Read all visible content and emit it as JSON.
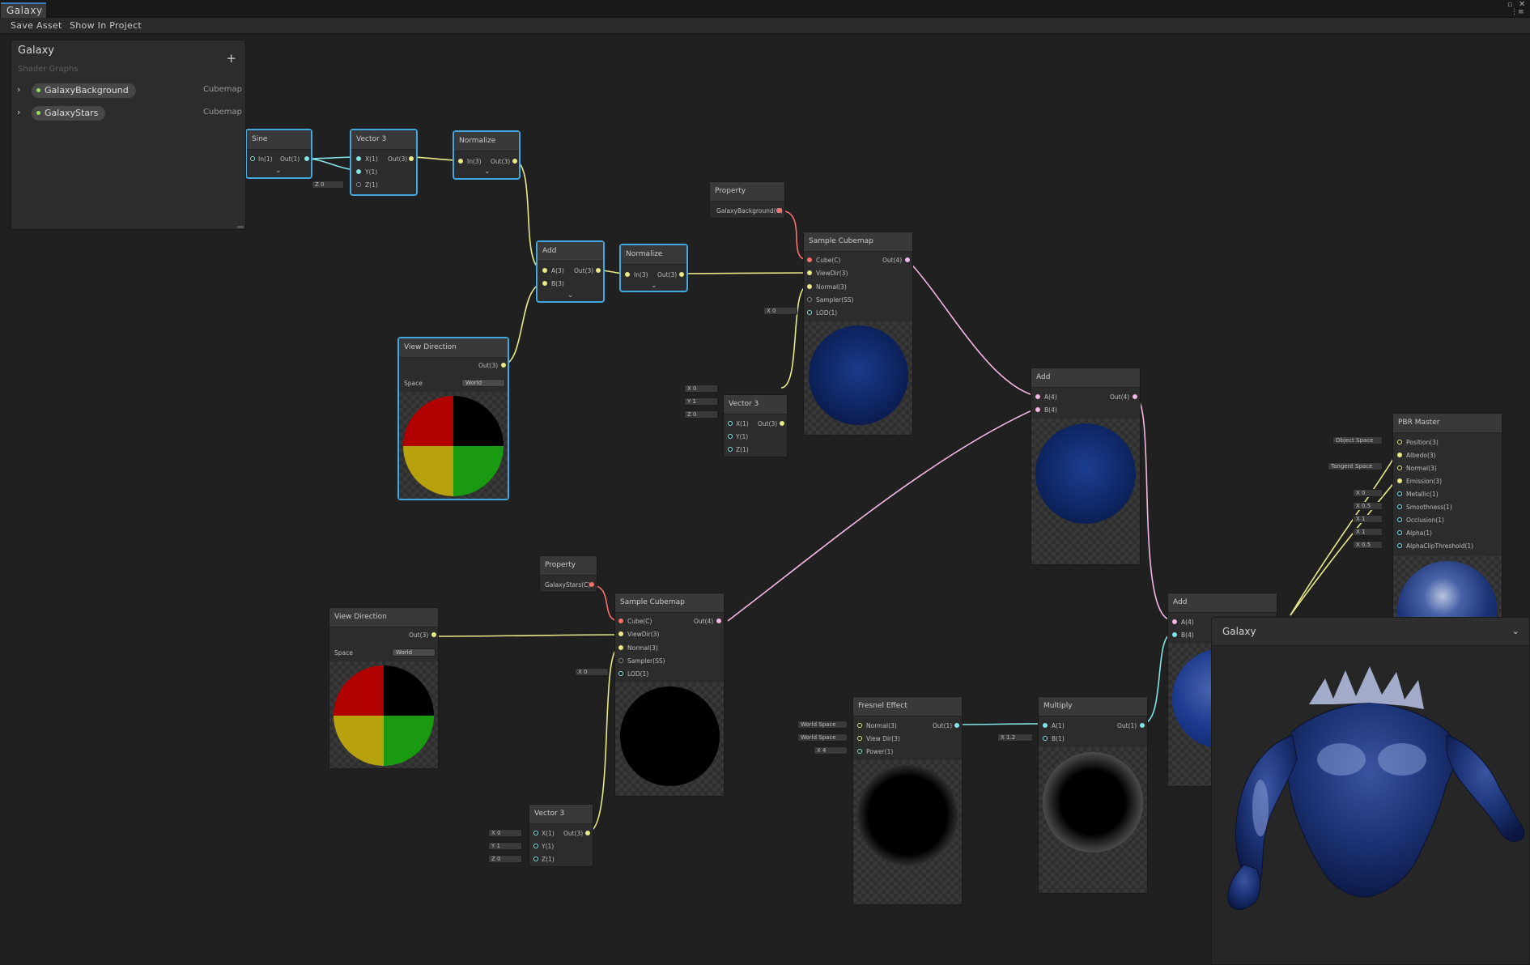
{
  "window": {
    "tab_title": "Galaxy"
  },
  "toolbar": {
    "save_asset": "Save Asset",
    "show_in_project": "Show In Project"
  },
  "blackboard": {
    "title": "Galaxy",
    "subtitle": "Shader Graphs",
    "add_symbol": "+",
    "properties": [
      {
        "name": "GalaxyBackground",
        "type": "Cubemap"
      },
      {
        "name": "GalaxyStars",
        "type": "Cubemap"
      }
    ]
  },
  "nodes": {
    "sine": {
      "title": "Sine",
      "in": "In(1)",
      "out": "Out(1)"
    },
    "vector3_top": {
      "title": "Vector 3",
      "x": "X(1)",
      "y": "Y(1)",
      "z": "Z(1)",
      "out": "Out(3)",
      "z_value": "Z 0"
    },
    "normalize_1": {
      "title": "Normalize",
      "in": "In(3)",
      "out": "Out(3)"
    },
    "add_1": {
      "title": "Add",
      "a": "A(3)",
      "b": "B(3)",
      "out": "Out(3)"
    },
    "normalize_2": {
      "title": "Normalize",
      "in": "In(3)",
      "out": "Out(3)"
    },
    "property_bg": {
      "title": "Property",
      "value": "GalaxyBackground(C)"
    },
    "sample_cubemap_1": {
      "title": "Sample Cubemap",
      "cube": "Cube(C)",
      "viewdir": "ViewDir(3)",
      "normal": "Normal(3)",
      "sampler": "Sampler(SS)",
      "lod": "LOD(1)",
      "out": "Out(4)",
      "lod_value": "X 0"
    },
    "view_direction_1": {
      "title": "View Direction",
      "out": "Out(3)",
      "space_label": "Space",
      "space_value": "World"
    },
    "vector3_mid": {
      "title": "Vector 3",
      "x": "X(1)",
      "y": "Y(1)",
      "z": "Z(1)",
      "out": "Out(3)",
      "x_value": "X 0",
      "y_value": "Y 1",
      "z_value": "Z 0"
    },
    "add_2": {
      "title": "Add",
      "a": "A(4)",
      "b": "B(4)",
      "out": "Out(4)"
    },
    "pbr_master": {
      "title": "PBR Master",
      "ports": [
        "Position(3)",
        "Albedo(3)",
        "Normal(3)",
        "Emission(3)",
        "Metallic(1)",
        "Smoothness(1)",
        "Occlusion(1)",
        "Alpha(1)",
        "AlphaClipThreshold(1)"
      ],
      "position_space": "Object Space",
      "normal_space": "Tangent Space",
      "metallic": "X 0",
      "smoothness": "X 0.5",
      "occlusion": "X 1",
      "alpha": "X 1",
      "alpha_clip": "X 0.5"
    },
    "property_stars": {
      "title": "Property",
      "value": "GalaxyStars(C)"
    },
    "sample_cubemap_2": {
      "title": "Sample Cubemap",
      "cube": "Cube(C)",
      "viewdir": "ViewDir(3)",
      "normal": "Normal(3)",
      "sampler": "Sampler(SS)",
      "lod": "LOD(1)",
      "out": "Out(4)",
      "lod_value": "X 0"
    },
    "view_direction_2": {
      "title": "View Direction",
      "out": "Out(3)",
      "space_label": "Space",
      "space_value": "World"
    },
    "vector3_bot": {
      "title": "Vector 3",
      "x": "X(1)",
      "y": "Y(1)",
      "z": "Z(1)",
      "out": "Out(3)",
      "x_value": "X 0",
      "y_value": "Y 1",
      "z_value": "Z 0"
    },
    "add_3": {
      "title": "Add",
      "a": "A(4)",
      "b": "B(4)"
    },
    "fresnel": {
      "title": "Fresnel Effect",
      "normal": "Normal(3)",
      "viewdir": "View Dir(3)",
      "power": "Power(1)",
      "out": "Out(1)",
      "normal_space": "World Space",
      "viewdir_space": "World Space",
      "power_value": "X 4"
    },
    "multiply": {
      "title": "Multiply",
      "a": "A(1)",
      "b": "B(1)",
      "out": "Out(1)",
      "b_value": "X 1.2"
    }
  },
  "main_preview": {
    "title": "Galaxy"
  },
  "colors": {
    "selection": "#44a8e0",
    "vector3_wire": "#e9e98a",
    "vector1_wire": "#84e4e7",
    "vector4_wire": "#f4b6e4",
    "cubemap_port": "#fb6f6f"
  }
}
